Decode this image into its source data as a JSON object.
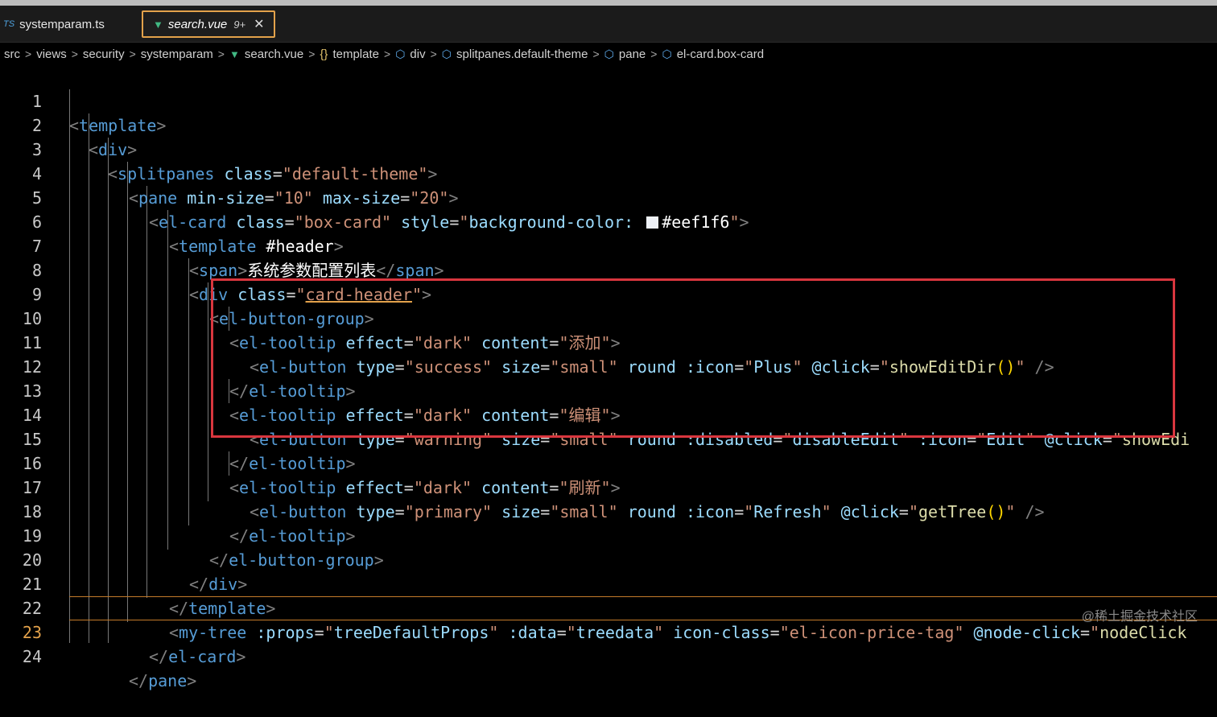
{
  "tabs": [
    {
      "icon_text": "TS",
      "label": "systemparam.ts"
    },
    {
      "label": "search.vue",
      "badge": "9+",
      "close": "✕"
    }
  ],
  "breadcrumb": [
    "src",
    "views",
    "security",
    "systemparam",
    "search.vue",
    "template",
    "div",
    "splitpanes.default-theme",
    "pane",
    "el-card.box-card"
  ],
  "code": {
    "line_numbers": [
      "1",
      "2",
      "3",
      "4",
      "5",
      "6",
      "7",
      "8",
      "9",
      "10",
      "11",
      "12",
      "13",
      "14",
      "15",
      "16",
      "17",
      "18",
      "19",
      "20",
      "21",
      "22",
      "23",
      "24"
    ],
    "active_line": "23",
    "tokens": {
      "template": "template",
      "div": "div",
      "splitpanes": "splitpanes",
      "pane": "pane",
      "el_card": "el-card",
      "span": "span",
      "el_button_group": "el-button-group",
      "el_tooltip": "el-tooltip",
      "el_button": "el-button",
      "my_tree": "my-tree",
      "class_attr": "class",
      "min_size_attr": "min-size",
      "max_size_attr": "max-size",
      "style_attr": "style",
      "effect_attr": "effect",
      "content_attr": "content",
      "type_attr": "type",
      "size_attr": "size",
      "round_attr": "round",
      "icon_attr": ":icon",
      "click_attr": "@click",
      "disabled_attr": ":disabled",
      "props_attr": ":props",
      "data_attr": ":data",
      "icon_class_attr": "icon-class",
      "node_click_attr": "@node-click",
      "header_slot": "#header",
      "default_theme": "default-theme",
      "min_val": "10",
      "max_val": "20",
      "box_card": "box-card",
      "bg_prop": "background-color:",
      "bg_color": "#eef1f6",
      "span_text": "系统参数配置列表",
      "card_header": "card-header",
      "dark": "dark",
      "add": "添加",
      "edit_cn": "编辑",
      "refresh_cn": "刷新",
      "success": "success",
      "warning": "warning",
      "primary": "primary",
      "small": "small",
      "plus": "Plus",
      "edit": "Edit",
      "refresh": "Refresh",
      "show_edit_dir": "showEditDir",
      "show_edi": "showEdi",
      "get_tree": "getTree",
      "disable_edit": "disableEdit",
      "tree_default_props": "treeDefaultProps",
      "treedata": "treedata",
      "price_tag": "el-icon-price-tag",
      "node_click": "nodeClick"
    }
  },
  "colors": {
    "square": "#eef1f6",
    "highlight": "#d9363e",
    "active_tab_border": "#e3a24b"
  },
  "watermark": "@稀土掘金技术社区"
}
